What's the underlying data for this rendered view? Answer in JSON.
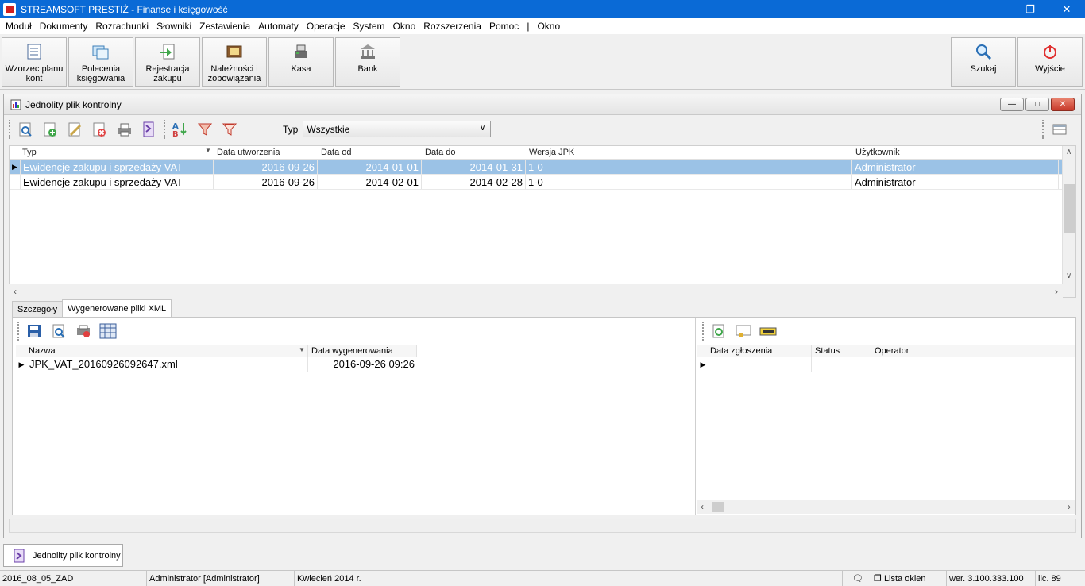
{
  "window": {
    "title": "STREAMSOFT PRESTIŻ - Finanse i księgowość"
  },
  "menu": [
    "Moduł",
    "Dokumenty",
    "Rozrachunki",
    "Słowniki",
    "Zestawienia",
    "Automaty",
    "Operacje",
    "System",
    "Okno",
    "Rozszerzenia",
    "Pomoc",
    "|",
    "Okno"
  ],
  "toolbar": {
    "b1": [
      "Wzorzec planu",
      "kont"
    ],
    "b2": [
      "Polecenia",
      "księgowania"
    ],
    "b3": [
      "Rejestracja",
      "zakupu"
    ],
    "b4": [
      "Należności i",
      "zobowiązania"
    ],
    "b5": "Kasa",
    "b6": "Bank",
    "search": "Szukaj",
    "exit": "Wyjście"
  },
  "child": {
    "title": "Jednolity plik kontrolny",
    "typ_label": "Typ",
    "typ_value": "Wszystkie"
  },
  "grid1": {
    "headers": [
      "Typ",
      "Data utworzenia",
      "Data od",
      "Data do",
      "Wersja JPK",
      "Użytkownik"
    ],
    "rows": [
      [
        "Ewidencje zakupu i sprzedaży VAT",
        "2016-09-26",
        "2014-01-01",
        "2014-01-31",
        "1-0",
        "Administrator"
      ],
      [
        "Ewidencje zakupu i sprzedaży VAT",
        "2016-09-26",
        "2014-02-01",
        "2014-02-28",
        "1-0",
        "Administrator"
      ]
    ]
  },
  "tabs": [
    "Szczegóły",
    "Wygenerowane pliki XML"
  ],
  "xml_grid": {
    "headers": [
      "Nazwa",
      "Data wygenerowania"
    ],
    "rows": [
      [
        "JPK_VAT_20160926092647.xml",
        "2016-09-26 09:26"
      ]
    ]
  },
  "report_grid": {
    "headers": [
      "Data zgłoszenia",
      "Status",
      "Operator"
    ]
  },
  "taskbar": {
    "item": "Jednolity plik kontrolny"
  },
  "status": {
    "db": "2016_08_05_ZAD",
    "user": "Administrator [Administrator]",
    "period": "Kwiecień 2014 r.",
    "windows": "Lista okien",
    "version": "wer. 3.100.333.100",
    "lic": "lic. 89"
  },
  "colors": {
    "titlebar": "#0a6ad6",
    "selection": "#9bc2e6"
  }
}
